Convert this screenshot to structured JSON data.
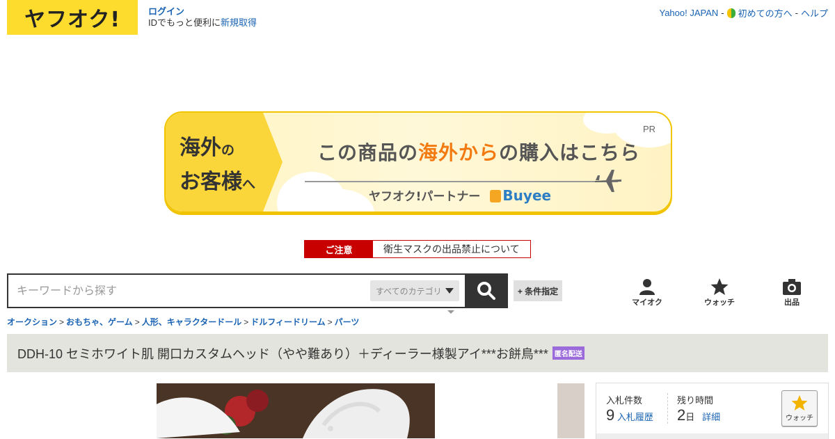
{
  "header": {
    "logo_text": "ヤフオク!",
    "login_label": "ログイン",
    "login_desc": "IDでもっと便利に",
    "signup_label": "新規取得",
    "links": {
      "yahoo_japan": "Yahoo! JAPAN",
      "beginners": "初めての方へ",
      "help": "ヘルプ",
      "separator": "-"
    }
  },
  "banner": {
    "left_line1": "海外",
    "left_line1_suffix": "の",
    "left_line2": "お客様",
    "left_line2_suffix": "へ",
    "headline_pre": "この商品の",
    "headline_accent": "海外から",
    "headline_post": "の購入はこちら",
    "pr_label": "PR",
    "partner_label": "ヤフオク!パートナー",
    "partner_brand": "Buyee",
    "colors": {
      "accent": "#f27a10",
      "yellow": "#fbd63a"
    }
  },
  "notice": {
    "tag": "ご注意",
    "text": "衛生マスクの出品禁止について"
  },
  "search": {
    "placeholder": "キーワードから探す",
    "category": "すべてのカテゴリ",
    "advanced": "+ 条件指定"
  },
  "utility_nav": {
    "my_auction": "マイオク",
    "watch": "ウォッチ",
    "sell": "出品"
  },
  "breadcrumb": {
    "items": [
      "オークション",
      "おもちゃ、ゲーム",
      "人形、キャラクタードール",
      "ドルフィードリーム",
      "パーツ"
    ],
    "separator": ">"
  },
  "item": {
    "title": "DDH-10 セミホワイト肌 開口カスタムヘッド（やや難あり）＋ディーラー様製アイ***お餅鳥***",
    "badge": "匿名配送"
  },
  "bid_panel": {
    "bid_count_label": "入札件数",
    "bid_count": "9",
    "bid_history_link": "入札履歴",
    "time_left_label": "残り時間",
    "time_left_value": "2",
    "time_left_unit": "日",
    "details_link": "詳細",
    "watch_label": "ウォッチ"
  }
}
